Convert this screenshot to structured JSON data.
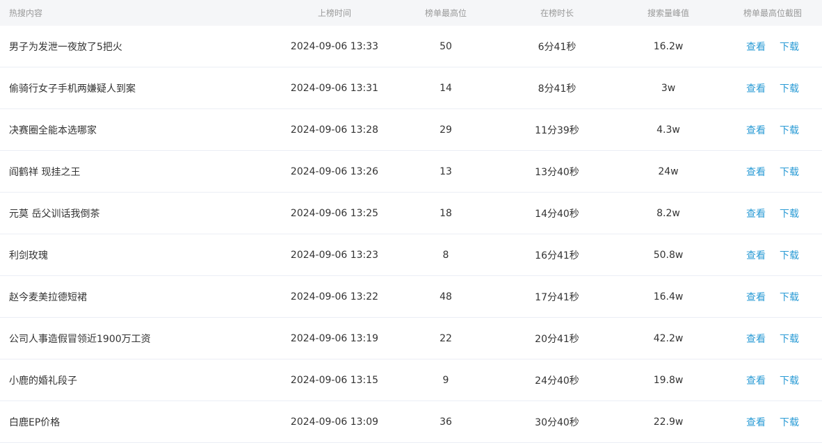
{
  "table": {
    "headers": {
      "title": "热搜内容",
      "time": "上榜时间",
      "rank": "榜单最高位",
      "duration": "在榜时长",
      "peak": "搜索量峰值",
      "screenshot": "榜单最高位截图"
    },
    "view_label": "查看",
    "download_label": "下载",
    "rows": [
      {
        "title": "男子为发泄一夜放了5把火",
        "time": "2024-09-06 13:33",
        "rank": "50",
        "duration": "6分41秒",
        "peak": "16.2w"
      },
      {
        "title": "偷骑行女子手机两嫌疑人到案",
        "time": "2024-09-06 13:31",
        "rank": "14",
        "duration": "8分41秒",
        "peak": "3w"
      },
      {
        "title": "决赛圈全能本选哪家",
        "time": "2024-09-06 13:28",
        "rank": "29",
        "duration": "11分39秒",
        "peak": "4.3w"
      },
      {
        "title": "阎鹤祥 现挂之王",
        "time": "2024-09-06 13:26",
        "rank": "13",
        "duration": "13分40秒",
        "peak": "24w"
      },
      {
        "title": "元莫 岳父训话我倒茶",
        "time": "2024-09-06 13:25",
        "rank": "18",
        "duration": "14分40秒",
        "peak": "8.2w"
      },
      {
        "title": "利剑玫瑰",
        "time": "2024-09-06 13:23",
        "rank": "8",
        "duration": "16分41秒",
        "peak": "50.8w"
      },
      {
        "title": "赵今麦美拉德短裙",
        "time": "2024-09-06 13:22",
        "rank": "48",
        "duration": "17分41秒",
        "peak": "16.4w"
      },
      {
        "title": "公司人事造假冒领近1900万工资",
        "time": "2024-09-06 13:19",
        "rank": "22",
        "duration": "20分41秒",
        "peak": "42.2w"
      },
      {
        "title": "小鹿的婚礼段子",
        "time": "2024-09-06 13:15",
        "rank": "9",
        "duration": "24分40秒",
        "peak": "19.8w"
      },
      {
        "title": "白鹿EP价格",
        "time": "2024-09-06 13:09",
        "rank": "36",
        "duration": "30分40秒",
        "peak": "22.9w"
      }
    ]
  },
  "colors": {
    "header_bg": "#f5f6f8",
    "header_text": "#999999",
    "body_text": "#333333",
    "link": "#2a9bd5",
    "divider": "#ebeef5"
  }
}
